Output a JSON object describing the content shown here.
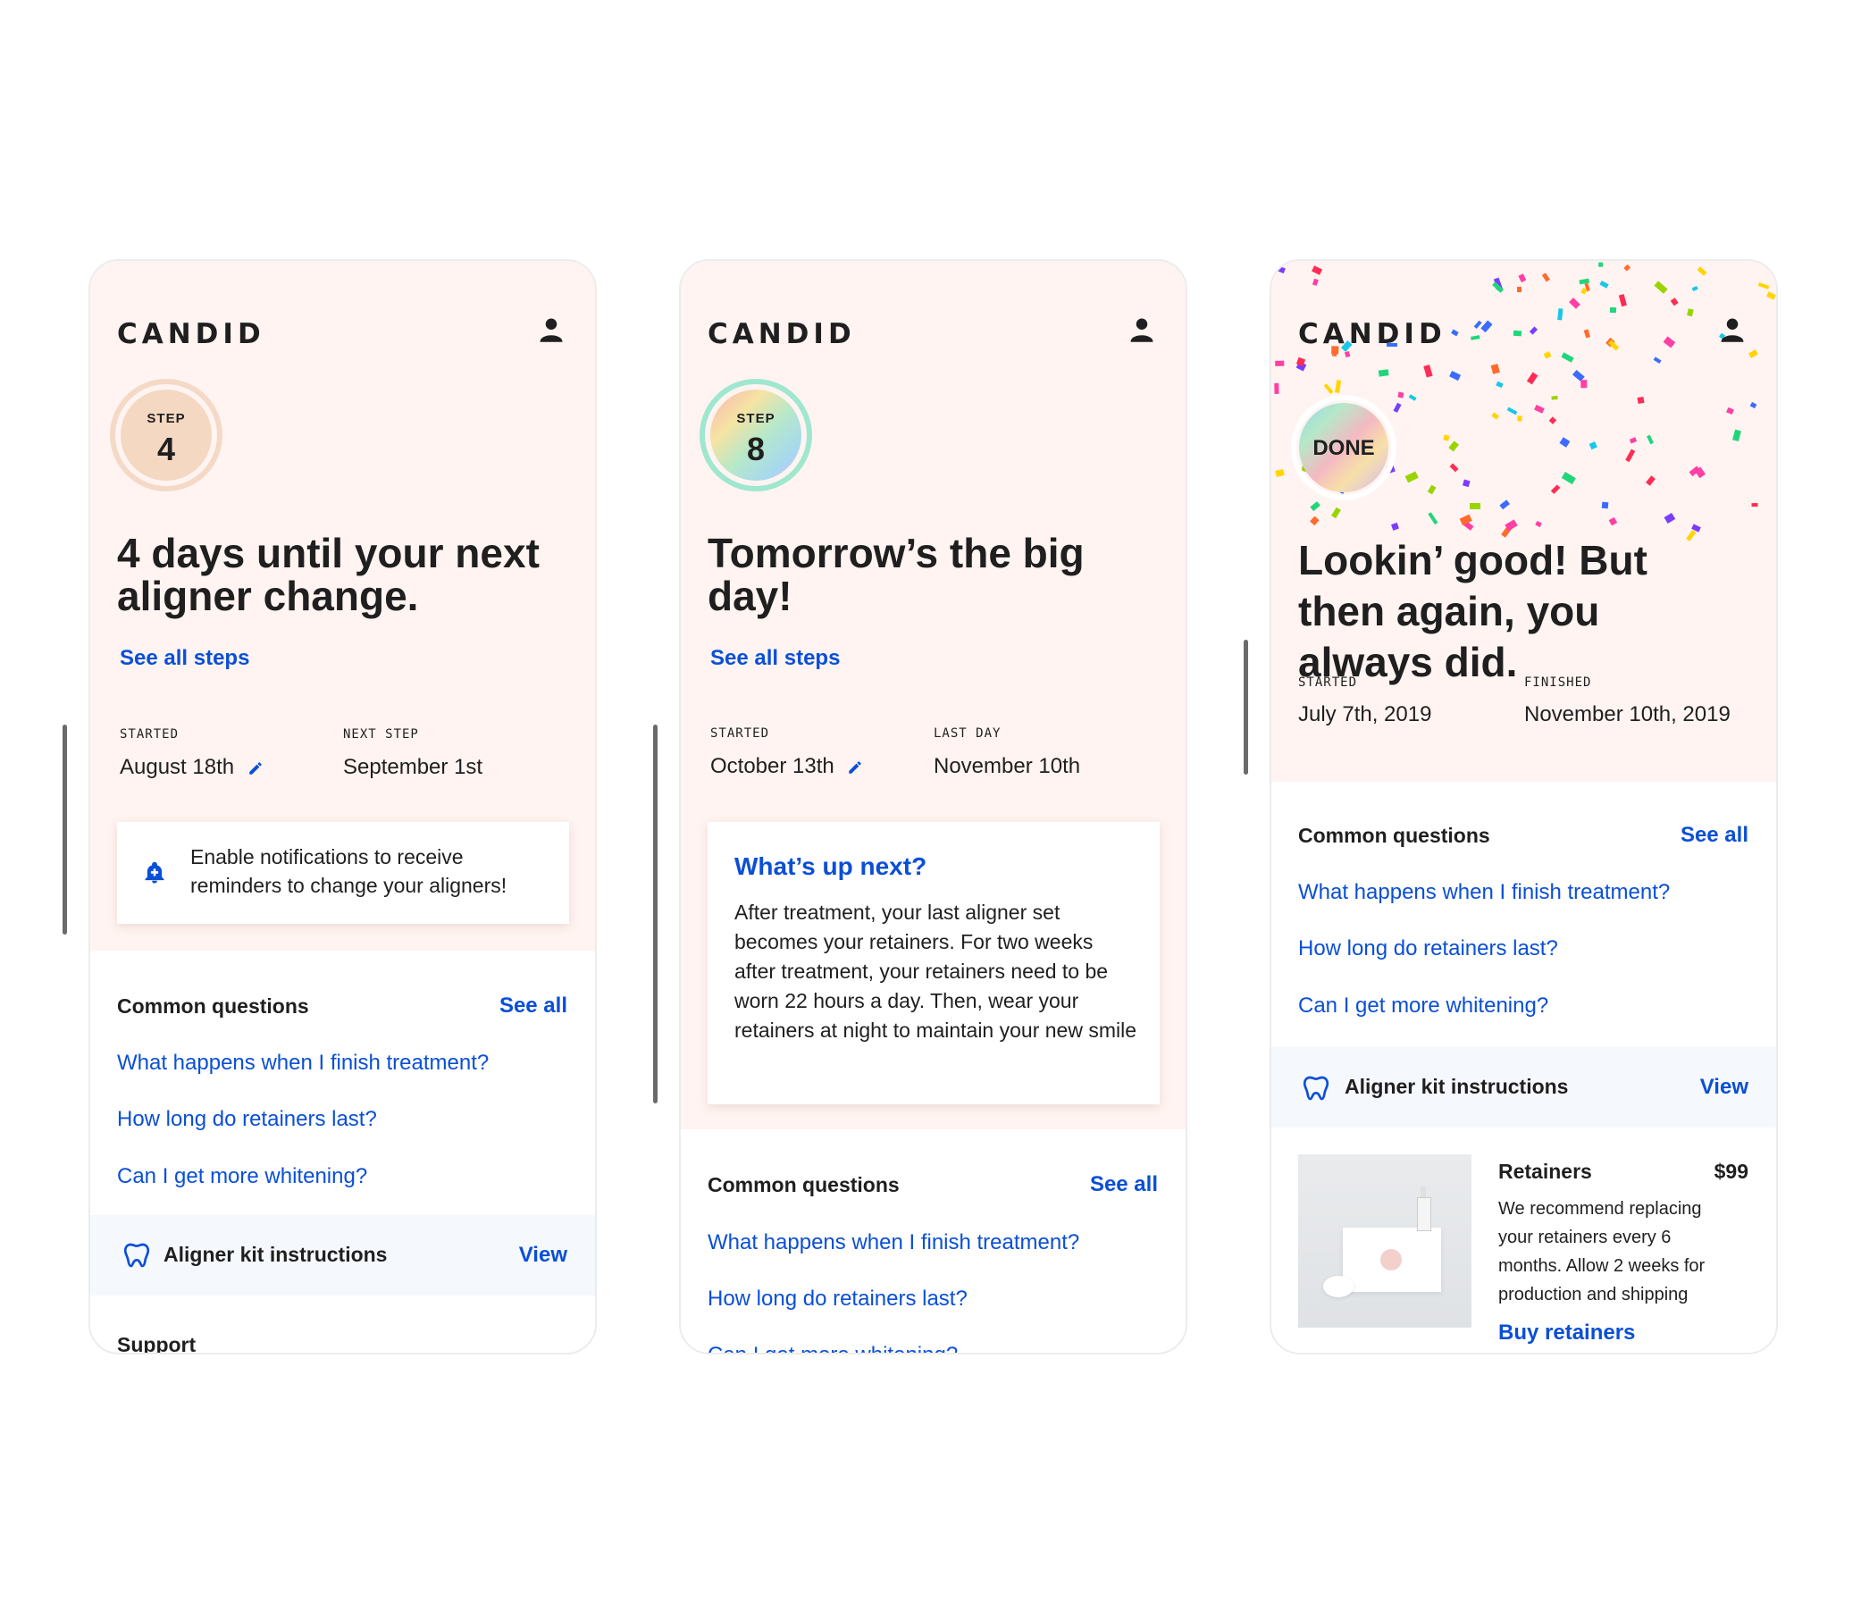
{
  "brand": {
    "logo": "CANDID"
  },
  "colors": {
    "link": "#0a4fd6",
    "hero_bg": "#fff4f1",
    "kit_bg": "#f5f8fc",
    "step4_badge": "#f4d8c2"
  },
  "screens": [
    {
      "badge": {
        "label": "STEP",
        "number": "4"
      },
      "headline": "4 days until your next aligner change.",
      "see_all_steps": "See all steps",
      "started_label": "STARTED",
      "started_value": "August 18th",
      "next_label": "NEXT STEP",
      "next_value": "September 1st",
      "notification": "Enable notifications to receive reminders to change your aligners!",
      "questions_title": "Common questions",
      "see_all": "See all",
      "questions": [
        "What happens when I finish treatment?",
        "How long do retainers last?",
        "Can I get more whitening?"
      ],
      "kit_label": "Aligner kit instructions",
      "kit_view": "View",
      "support": "Support"
    },
    {
      "badge": {
        "label": "STEP",
        "number": "8"
      },
      "headline": "Tomorrow’s the big day!",
      "see_all_steps": "See all steps",
      "started_label": "STARTED",
      "started_value": "October 13th",
      "next_label": "LAST DAY",
      "next_value": "November 10th",
      "whats_next_title": "What’s up next?",
      "whats_next_body": "After treatment, your last aligner set becomes your retainers. For two weeks after treatment, your retainers need to be worn 22 hours a day. Then, wear your retainers at night to maintain your new smile",
      "questions_title": "Common questions",
      "see_all": "See all",
      "questions": [
        "What happens when I finish treatment?",
        "How long do retainers last?",
        "Can I get more whitening?"
      ]
    },
    {
      "badge": {
        "label": "DONE"
      },
      "headline": "Lookin’ good! But then again, you always did.",
      "started_label": "STARTED",
      "started_value": "July 7th, 2019",
      "finished_label": "FINISHED",
      "finished_value": "November 10th, 2019",
      "questions_title": "Common questions",
      "see_all": "See all",
      "questions": [
        "What happens when I finish treatment?",
        "How long do retainers last?",
        "Can I get more whitening?"
      ],
      "kit_label": "Aligner kit instructions",
      "kit_view": "View",
      "product": {
        "title": "Retainers",
        "price": "$99",
        "description": "We recommend replacing your retainers every 6 months. Allow 2 weeks for production and shipping",
        "cta": "Buy retainers"
      }
    }
  ]
}
